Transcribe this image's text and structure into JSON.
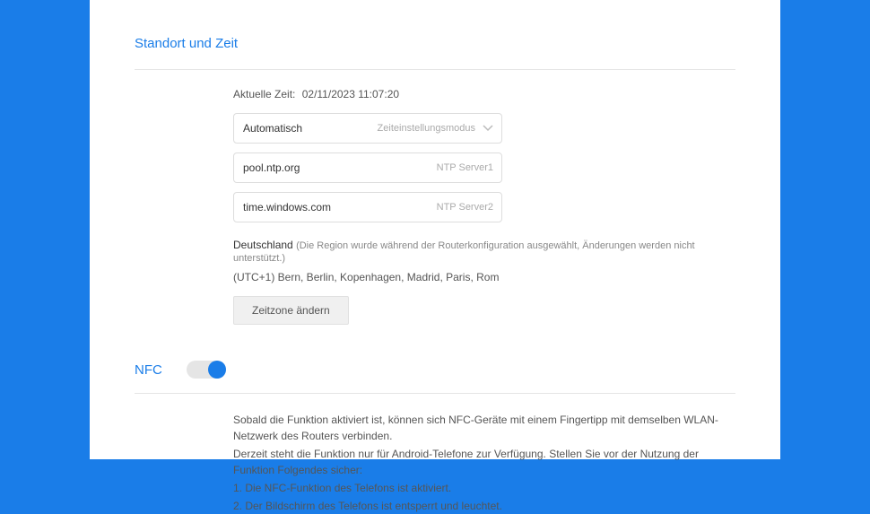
{
  "locationTime": {
    "title": "Standort und Zeit",
    "currentTimeLabel": "Aktuelle Zeit:",
    "currentTimeValue": "02/11/2023 11:07:20",
    "timeMode": {
      "value": "Automatisch",
      "label": "Zeiteinstellungsmodus"
    },
    "ntp1": {
      "value": "pool.ntp.org",
      "label": "NTP Server1"
    },
    "ntp2": {
      "value": "time.windows.com",
      "label": "NTP Server2"
    },
    "regionName": "Deutschland",
    "regionNote": "(Die Region wurde während der Routerkonfiguration ausgewählt, Änderungen werden nicht unterstützt.)",
    "timezoneText": "(UTC+1) Bern, Berlin, Kopenhagen, Madrid, Paris, Rom",
    "changeTimezoneButton": "Zeitzone ändern"
  },
  "nfc": {
    "title": "NFC",
    "descLine1": "Sobald die Funktion aktiviert ist, können sich NFC-Geräte mit einem Fingertipp mit demselben WLAN-Netzwerk des Routers verbinden.",
    "descLine2": "Derzeit steht die Funktion nur für Android-Telefone zur Verfügung. Stellen Sie vor der Nutzung der Funktion Folgendes sicher:",
    "descLine3": "1. Die NFC-Funktion des Telefons ist aktiviert.",
    "descLine4": "2. Der Bildschirm des Telefons ist entsperrt und leuchtet."
  }
}
